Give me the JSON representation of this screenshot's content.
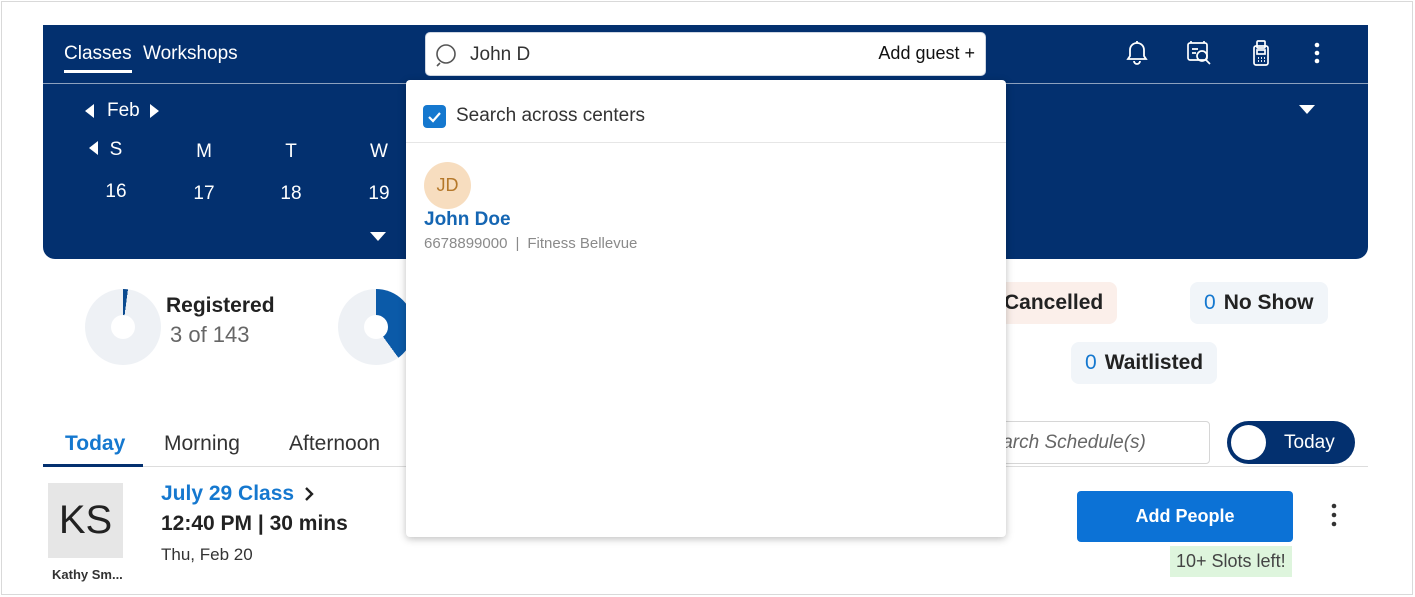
{
  "nav": {
    "tabs": [
      {
        "label": "Classes",
        "active": true
      },
      {
        "label": "Workshops",
        "active": false
      }
    ],
    "icons": [
      "bell-icon",
      "search-scan-icon",
      "card-reader-icon",
      "more-vertical-icon"
    ]
  },
  "search": {
    "value": "John D",
    "add_guest_label": "Add guest +"
  },
  "dropdown": {
    "checkbox_label": "Search across centers",
    "checkbox_checked": true,
    "results": [
      {
        "initials": "JD",
        "name": "John Doe",
        "phone": "6678899000",
        "separator": "|",
        "center": "Fitness Bellevue"
      }
    ]
  },
  "calendar": {
    "month": "Feb",
    "days": [
      {
        "dow": "S",
        "date": "16"
      },
      {
        "dow": "M",
        "date": "17"
      },
      {
        "dow": "T",
        "date": "18"
      },
      {
        "dow": "W",
        "date": "19"
      }
    ]
  },
  "stats": {
    "registered": {
      "title": "Registered",
      "sub": "3  of 143",
      "fraction": 0.021
    },
    "second_ring_fraction": 0.4,
    "cancelled_label": "Cancelled",
    "no_show": {
      "count": "0",
      "label": "No Show"
    },
    "waitlisted": {
      "count": "0",
      "label": "Waitlisted"
    }
  },
  "schedule_tabs": [
    {
      "label": "Today",
      "active": true
    },
    {
      "label": "Morning",
      "active": false
    },
    {
      "label": "Afternoon",
      "active": false
    }
  ],
  "schedule_search": {
    "placeholder": "Search Schedule(s)"
  },
  "today_toggle": {
    "label": "Today"
  },
  "class_card": {
    "instructor_initials": "KS",
    "instructor_name": "Kathy Sm...",
    "title": "July 29 Class",
    "time": "12:40 PM | 30 mins",
    "date": "Thu, Feb 20",
    "add_people_label": "Add People",
    "slots_label": "10+ Slots left!"
  },
  "colors": {
    "header_bg": "#03306f",
    "accent": "#1578cf",
    "button": "#0c72d6",
    "slots_bg": "#def5dd",
    "avatar_bg": "#f7ddbf"
  }
}
